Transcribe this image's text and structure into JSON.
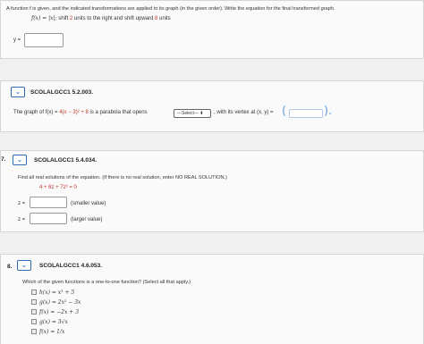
{
  "q_top": {
    "prompt": "A function f is given, and the indicated transformations are applied to its graph (in the given order). Write the equation for the final transformed graph.",
    "func": "f(x) = |x|;",
    "shift_a": " shift ",
    "shift_a_val": "2",
    "shift_a_rest": " units to the right and shift upward ",
    "shift_b_val": "8",
    "shift_b_rest": " units",
    "answer_label": "y ="
  },
  "q6": {
    "code": "SCOLALGCC1 5.2.003.",
    "text_start": "The graph of f(x) = ",
    "func_red": "4(x − 3)² + 8",
    "text_mid": " is a parabola that opens",
    "select_label": "---Select--- ⬍",
    "text_end": ", with its vertex at (x, y) =",
    "paren_open": "(",
    "paren_close": ")."
  },
  "q7": {
    "number": "7.",
    "code": "SCOLALGCC1 5.4.034.",
    "prompt": "Find all real solutions of the equation. (If there is no real solution, enter NO REAL SOLUTION.)",
    "equation": "4 + 6z + 7z² = 0",
    "z_label": "z =",
    "smaller": "(smaller value)",
    "larger": "(larger value)"
  },
  "q8": {
    "number": "8.",
    "code": "SCOLALGCC1 4.6.053.",
    "prompt": "Which of the given functions is a one-to-one function? (Select all that apply.)",
    "options": [
      "h(x) = x³ + 5",
      "g(x) = 2x² − 3x",
      "f(x) = −2x + 3",
      "g(x) = 3√x",
      "f(x) = 1/x"
    ]
  },
  "icons": {
    "chevron": "chevron-down-icon"
  }
}
